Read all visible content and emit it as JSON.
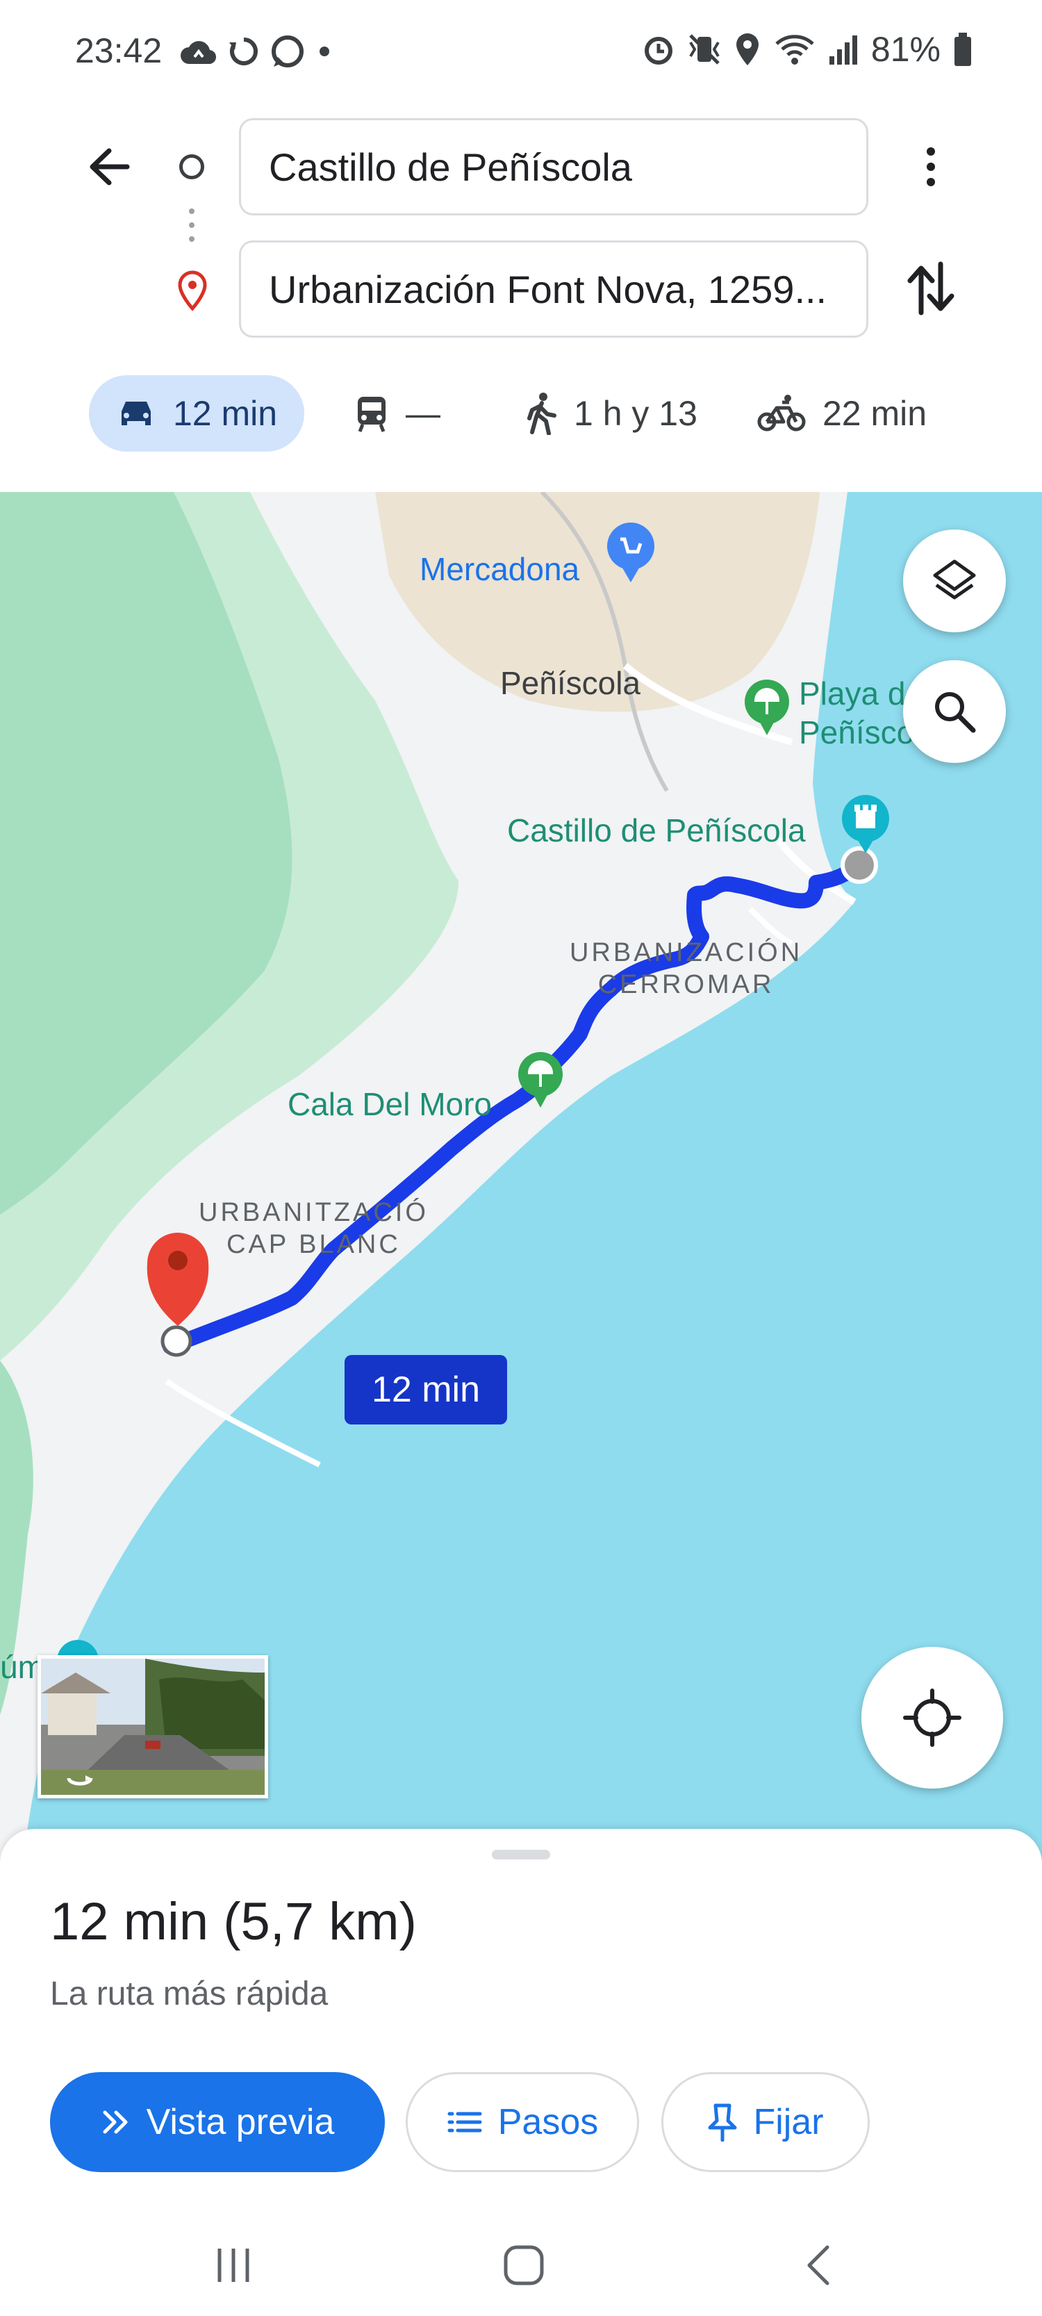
{
  "status_bar": {
    "time": "23:42",
    "battery": "81%",
    "left_icons": [
      "cloud-sync-icon",
      "sync-icon",
      "whatsapp-icon",
      "dot-icon"
    ],
    "right_icons": [
      "alarm-icon",
      "vibrate-icon",
      "location-icon",
      "wifi-icon",
      "signal-icon",
      "battery-icon"
    ]
  },
  "search": {
    "origin": "Castillo de Peñíscola",
    "destination": "Urbanización Font Nova, 1259..."
  },
  "modes": [
    {
      "icon": "car-icon",
      "label": "12 min",
      "selected": true
    },
    {
      "icon": "transit-icon",
      "label": "—",
      "selected": false
    },
    {
      "icon": "walk-icon",
      "label": "1 h y 13",
      "selected": false
    },
    {
      "icon": "bike-icon",
      "label": "22 min",
      "selected": false
    }
  ],
  "map": {
    "labels": {
      "mercadona": "Mercadona",
      "peniscola": "Peñíscola",
      "playa": "Playa d\nPeñísco",
      "castillo": "Castillo de Peñíscola",
      "urb_cerromar": "URBANIZACIÓN\nCERROMAR",
      "cala_moro": "Cala Del Moro",
      "urb_cap_blanc": "URBANITZACIÓ\nCAP BLANC",
      "edge": "úm"
    },
    "route_time": "12 min",
    "colors": {
      "sea": "#8fdcef",
      "land": "#f1f3f4",
      "green": "#c8ebd6",
      "route": "#1a3be8",
      "pin": "#e53935"
    }
  },
  "sheet": {
    "summary": "12 min (5,7 km)",
    "subtitle": "La ruta más rápida",
    "buttons": {
      "preview": "Vista previa",
      "steps": "Pasos",
      "pin": "Fijar"
    }
  }
}
